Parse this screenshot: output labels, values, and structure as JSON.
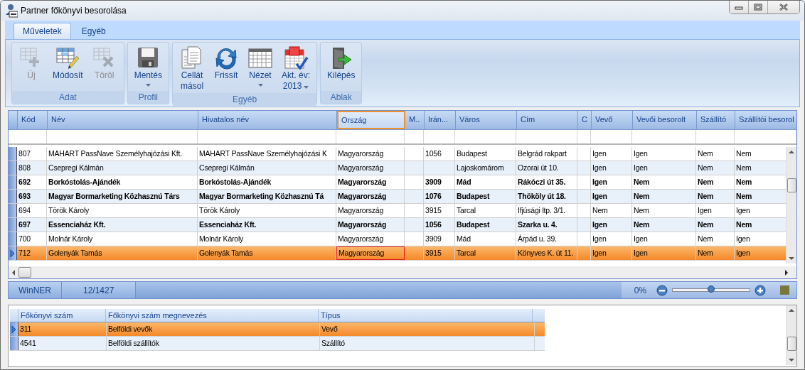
{
  "window": {
    "title": "Partner főkönyvi besorolása"
  },
  "tabs": [
    {
      "label": "Műveletek",
      "selected": true
    },
    {
      "label": "Egyéb",
      "selected": false
    }
  ],
  "ribbon": {
    "groups": [
      {
        "label": "Adat",
        "items": [
          {
            "kind": "new",
            "label": "Új",
            "disabled": true
          },
          {
            "kind": "edit",
            "label": "Módosít",
            "disabled": false
          },
          {
            "kind": "delete",
            "label": "Töröl",
            "disabled": true
          }
        ]
      },
      {
        "label": "Profil",
        "items": [
          {
            "kind": "save",
            "label": "Mentés",
            "disabled": false,
            "dropdown": true
          }
        ]
      },
      {
        "label": "Egyéb",
        "items": [
          {
            "kind": "copy",
            "label": "Cellát\nmásol",
            "disabled": false
          },
          {
            "kind": "refresh",
            "label": "Frissít",
            "disabled": false
          },
          {
            "kind": "view",
            "label": "Nézet",
            "disabled": false,
            "dropdown": true
          },
          {
            "kind": "year",
            "label": "Akt. év:",
            "value": "2013",
            "disabled": false,
            "dropdown": true
          }
        ]
      },
      {
        "label": "Ablak",
        "items": [
          {
            "kind": "exit",
            "label": "Kilépés",
            "disabled": false
          }
        ]
      }
    ]
  },
  "grid": {
    "columns": [
      {
        "label": "Kód",
        "selected": false
      },
      {
        "label": "Név",
        "selected": false
      },
      {
        "label": "Hivatalos név",
        "selected": false
      },
      {
        "label": "Ország",
        "selected": true
      },
      {
        "label": "M..",
        "selected": false
      },
      {
        "label": "Irán...",
        "selected": false
      },
      {
        "label": "Város",
        "selected": false
      },
      {
        "label": "Cím",
        "selected": false
      },
      {
        "label": "C",
        "selected": false
      },
      {
        "label": "Vevő",
        "selected": false
      },
      {
        "label": "Vevői besorolt",
        "selected": false
      },
      {
        "label": "Szállító",
        "selected": false
      },
      {
        "label": "Szállítói besorol",
        "selected": false
      }
    ],
    "rows": [
      {
        "bold": false,
        "selected": false,
        "cells": [
          "807",
          "MAHART PassNave Személyhajózási Kft.",
          "MAHART PassNave Személyhajózási K",
          "Magyarország",
          "",
          "1056",
          "Budapest",
          "Belgrád rakpart",
          "",
          "Igen",
          "Igen",
          "Nem",
          "Nem"
        ]
      },
      {
        "bold": false,
        "selected": false,
        "cells": [
          "808",
          "Csepregi Kálmán",
          "Csepregi Kálmán",
          "Magyarország",
          "",
          "",
          "Lajoskomárom",
          "Ozorai út 10.",
          "",
          "Igen",
          "Igen",
          "Nem",
          "Nem"
        ]
      },
      {
        "bold": true,
        "selected": false,
        "cells": [
          "692",
          "Borkóstolás-Ajándék",
          "Borkóstolás-Ajándék",
          "Magyarország",
          "",
          "3909",
          "Mád",
          "Rákóczi út 35.",
          "",
          "Igen",
          "Nem",
          "Nem",
          "Nem"
        ]
      },
      {
        "bold": true,
        "selected": false,
        "cells": [
          "693",
          "Magyar Bormarketing Közhasznú Társ",
          "Magyar Bormarketing Közhasznú Tá",
          "Magyarország",
          "",
          "1076",
          "Budapest",
          "Thököly út 18.",
          "",
          "Igen",
          "Nem",
          "Nem",
          "Nem"
        ]
      },
      {
        "bold": false,
        "selected": false,
        "cells": [
          "694",
          "Török Károly",
          "Török Károly",
          "Magyarország",
          "",
          "3915",
          "Tarcal",
          "Ifjúsági ltp. 3/1.",
          "",
          "Nem",
          "Nem",
          "Igen",
          "Igen"
        ]
      },
      {
        "bold": true,
        "selected": false,
        "cells": [
          "697",
          "Essenciaház Kft.",
          "Essenciaház Kft.",
          "Magyarország",
          "",
          "1056",
          "Budapest",
          "Szarka u. 4.",
          "",
          "Igen",
          "Nem",
          "Nem",
          "Nem"
        ]
      },
      {
        "bold": false,
        "selected": false,
        "cells": [
          "700",
          "Molnár Károly",
          "Molnár Károly",
          "Magyarország",
          "",
          "3909",
          "Mád",
          "Árpád u. 39.",
          "",
          "Igen",
          "Igen",
          "Nem",
          "Igen"
        ]
      },
      {
        "bold": false,
        "selected": true,
        "cells": [
          "712",
          "Golenyák Tamás",
          "Golenyák Tamás",
          "Magyarország",
          "",
          "3915",
          "Tarcal",
          "Könyves K. út 11.",
          "",
          "Igen",
          "Igen",
          "Nem",
          "Igen"
        ]
      }
    ]
  },
  "status_bar": {
    "app": "WinNER",
    "position": "12/1427",
    "zoom": "0%",
    "zoom_slider": {
      "level": 0.5
    },
    "swatch": {
      "color": "#79773a"
    }
  },
  "ledger_grid": {
    "columns": [
      "Főkönyvi szám",
      "Főkönyvi szám megnevezés",
      "Típus"
    ],
    "rows": [
      {
        "selected": true,
        "cells": [
          "311",
          "Belföldi vevők",
          "Vevő"
        ]
      },
      {
        "selected": false,
        "cells": [
          "4541",
          "Belföldi szállítók",
          "Szállító"
        ]
      }
    ]
  }
}
